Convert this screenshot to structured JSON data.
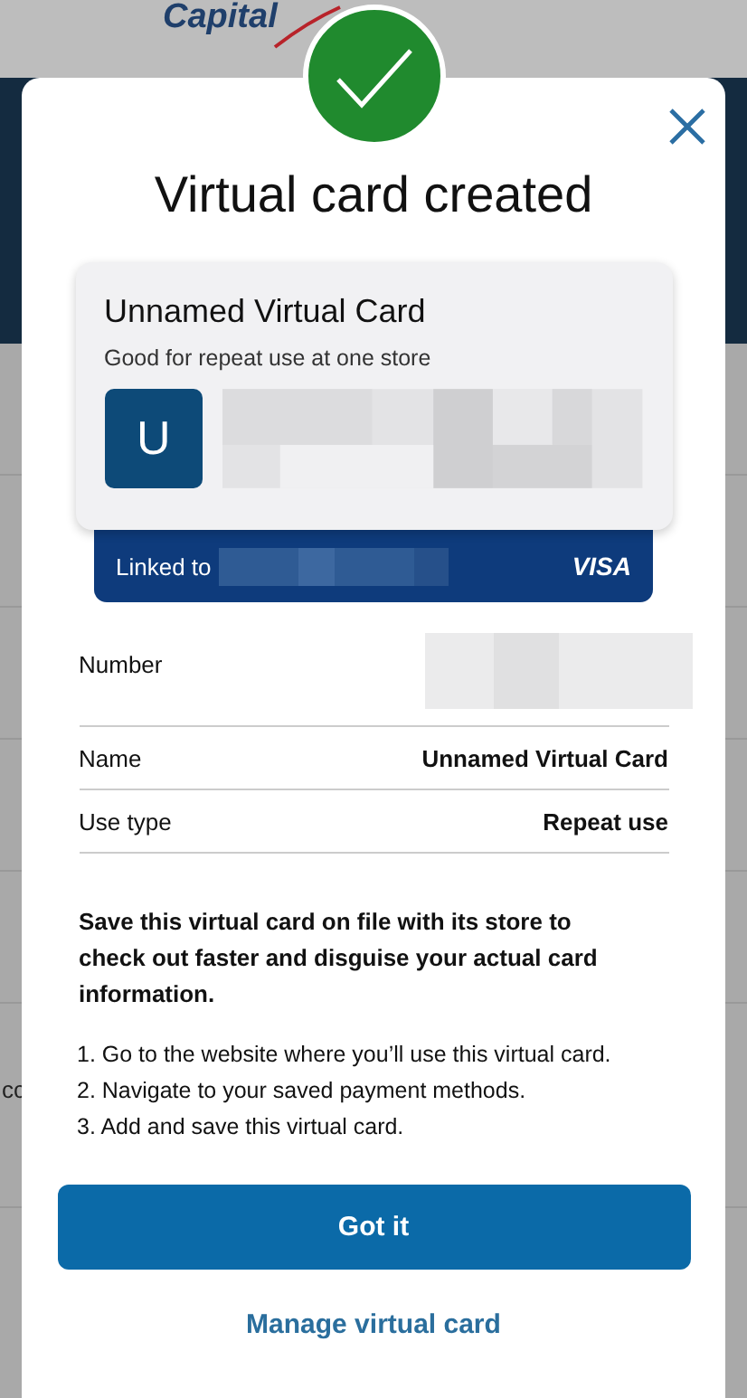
{
  "background": {
    "logo": "Capital",
    "fragment": "cc"
  },
  "dialog": {
    "title": "Virtual card created",
    "card": {
      "name": "Unnamed Virtual Card",
      "subtitle": "Good for repeat use at one store",
      "avatar": "U",
      "linked_label": "Linked to",
      "network": "VISA"
    },
    "details": [
      {
        "label": "Number",
        "redacted": true
      },
      {
        "label": "Name",
        "value": "Unnamed Virtual Card",
        "redacted": false
      },
      {
        "label": "Use type",
        "value": "Repeat use",
        "redacted": false
      }
    ],
    "note": "Save this virtual card on file with its store to check out faster and disguise your actual card information.",
    "steps": [
      "1. Go to the website where you’ll use this virtual card.",
      "2. Navigate to your saved payment methods.",
      "3. Add and save this virtual card."
    ],
    "primary_button": "Got it",
    "link": "Manage virtual card"
  }
}
